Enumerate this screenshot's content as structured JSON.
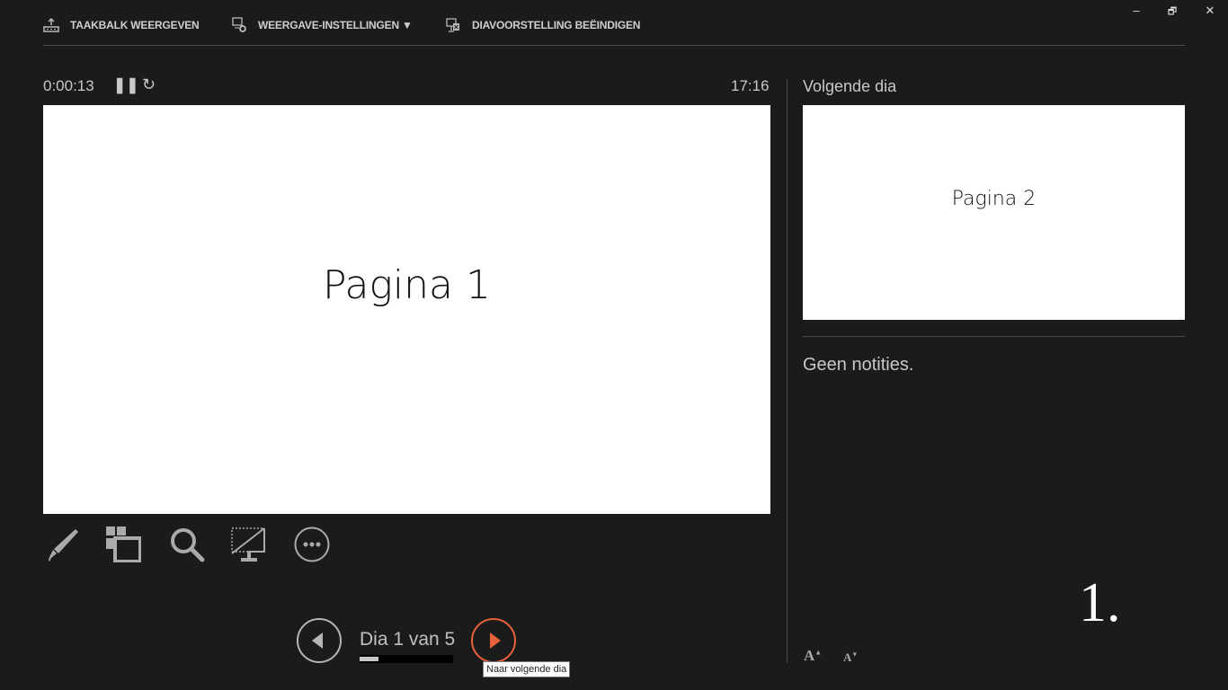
{
  "toolbar": {
    "show_taskbar": "TAAKBALK WEERGEVEN",
    "display_settings": "WEERGAVE-INSTELLINGEN ▼",
    "end_slideshow": "DIAVOORSTELLING BEËINDIGEN"
  },
  "window": {
    "minimize": "–",
    "restore": "🗗",
    "close": "✕"
  },
  "timer": {
    "elapsed": "0:00:13",
    "clock": "17:16"
  },
  "current_slide": {
    "title": "Pagina 1"
  },
  "next_slide": {
    "heading": "Volgende dia",
    "title": "Pagina 2"
  },
  "notes": {
    "text": "Geen notities.",
    "slide_number": "1."
  },
  "nav": {
    "counter": "Dia 1 van 5",
    "current": 1,
    "total": 5,
    "progress_percent": 20,
    "tooltip": "Naar volgende dia"
  },
  "colors": {
    "accent": "#e8613c",
    "background": "#1b1b1b"
  }
}
